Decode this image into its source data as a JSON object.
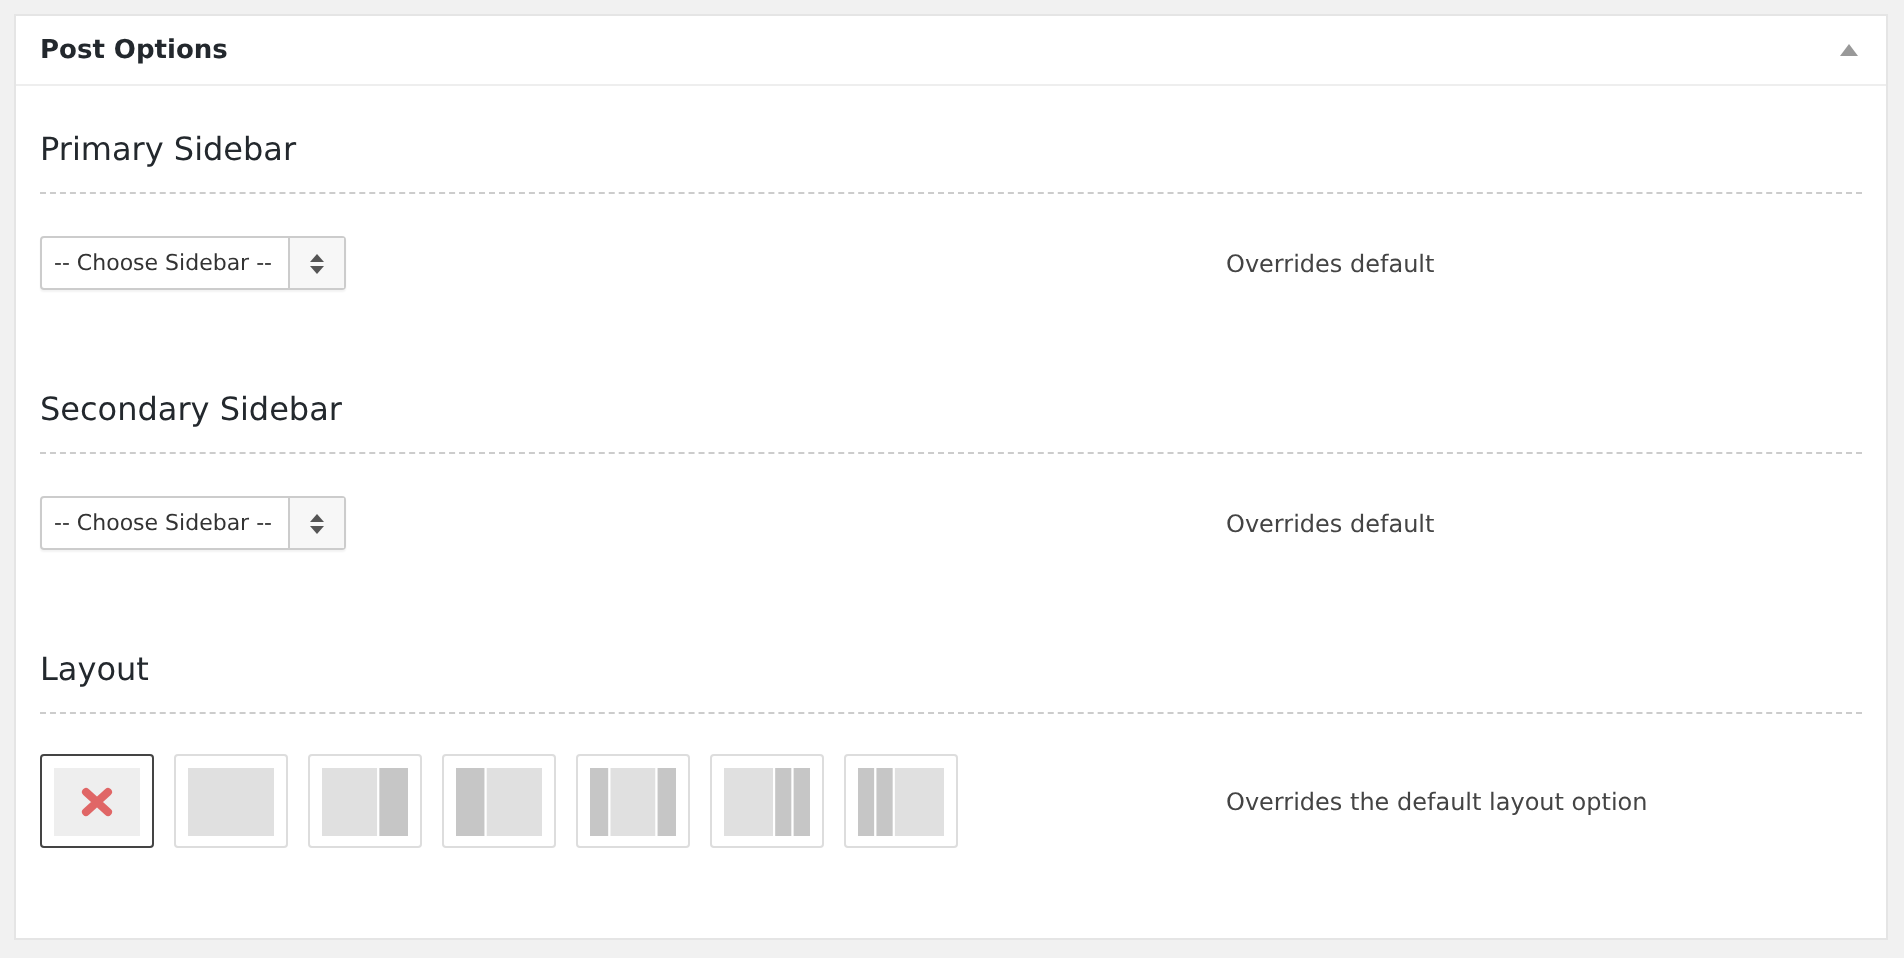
{
  "panel": {
    "title": "Post Options",
    "expanded": true
  },
  "sections": [
    {
      "kind": "select",
      "heading": "Primary Sidebar",
      "value": "-- Choose Sidebar --",
      "note": "Overrides default"
    },
    {
      "kind": "select",
      "heading": "Secondary Sidebar",
      "value": "-- Choose Sidebar --",
      "note": "Overrides default"
    },
    {
      "kind": "layouts",
      "heading": "Layout",
      "note": "Overrides the default layout option",
      "options": [
        {
          "kind": "none",
          "selected": true
        },
        {
          "kind": "full",
          "selected": false
        },
        {
          "kind": "cs",
          "selected": false
        },
        {
          "kind": "sc",
          "selected": false
        },
        {
          "kind": "scs",
          "selected": false
        },
        {
          "kind": "css",
          "selected": false
        },
        {
          "kind": "ssc",
          "selected": false
        }
      ]
    }
  ]
}
